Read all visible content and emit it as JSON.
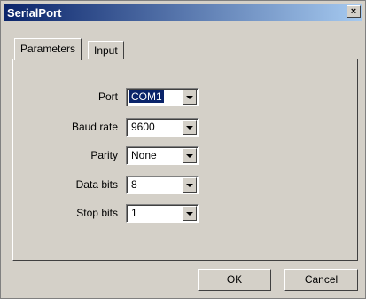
{
  "window": {
    "title": "SerialPort",
    "close_glyph": "×"
  },
  "tabs": [
    {
      "label": "Parameters",
      "active": true
    },
    {
      "label": "Input",
      "active": false
    }
  ],
  "fields": {
    "port": {
      "label": "Port",
      "value": "COM1"
    },
    "baud_rate": {
      "label": "Baud rate",
      "value": "9600"
    },
    "parity": {
      "label": "Parity",
      "value": "None"
    },
    "data_bits": {
      "label": "Data bits",
      "value": "8"
    },
    "stop_bits": {
      "label": "Stop bits",
      "value": "1"
    }
  },
  "buttons": {
    "ok": "OK",
    "cancel": "Cancel"
  },
  "colors": {
    "titlebar": "#0a246a",
    "face": "#d4d0c8",
    "selection": "#0a246a"
  }
}
